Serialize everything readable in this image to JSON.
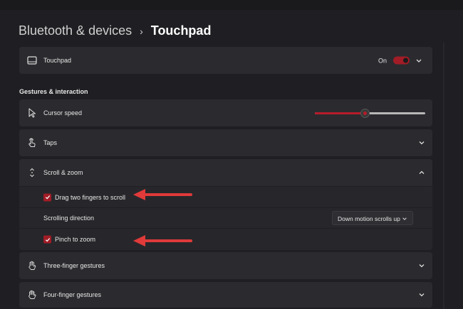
{
  "breadcrumb": {
    "parent": "Bluetooth & devices",
    "separator": "›",
    "current": "Touchpad"
  },
  "touchpad": {
    "label": "Touchpad",
    "state": "On",
    "enabled": true
  },
  "section": {
    "title": "Gestures & interaction"
  },
  "cursor_speed": {
    "label": "Cursor speed",
    "level_percent": 45
  },
  "taps": {
    "label": "Taps"
  },
  "scroll_zoom": {
    "label": "Scroll & zoom",
    "drag_two_fingers": {
      "label": "Drag two fingers to scroll",
      "checked": true
    },
    "scrolling_direction": {
      "label": "Scrolling direction",
      "value": "Down motion scrolls up"
    },
    "pinch_to_zoom": {
      "label": "Pinch to zoom",
      "checked": true
    }
  },
  "three_finger": {
    "label": "Three-finger gestures"
  },
  "four_finger": {
    "label": "Four-finger gestures"
  },
  "colors": {
    "accent": "#a11c26",
    "annotation_arrow": "#e03a3a",
    "background": "#1f1f23",
    "card": "#2b2b2f"
  }
}
